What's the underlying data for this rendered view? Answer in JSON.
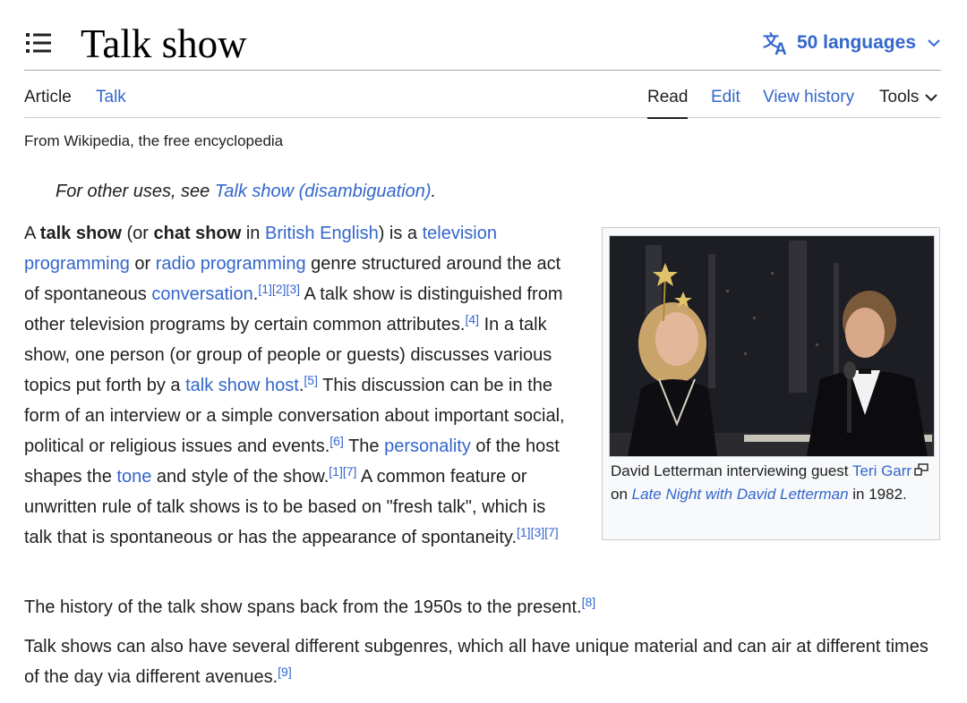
{
  "page": {
    "title": "Talk show",
    "languages_label": "50 languages"
  },
  "tabs": {
    "article": "Article",
    "talk": "Talk",
    "read": "Read",
    "edit": "Edit",
    "view_history": "View history",
    "tools": "Tools"
  },
  "tagline": "From Wikipedia, the free encyclopedia",
  "hatnote": {
    "prefix": "For other uses, see ",
    "link": "Talk show (disambiguation)",
    "suffix": "."
  },
  "lead": {
    "s1": "A ",
    "b1": "talk show",
    "s2": " (or ",
    "b2": "chat show",
    "s3": " in ",
    "l_british": "British English",
    "s4": ") is a ",
    "l_tv": "television programming",
    "s5": " or ",
    "l_radio": "radio programming",
    "s6": " genre structured around the act of spontaneous ",
    "l_conv": "conversation",
    "s7": ".",
    "r1": "[1][2][3]",
    "s8": " A talk show is distinguished from other television programs by certain common attributes.",
    "r2": "[4]",
    "s9": " In a talk show, one person (or group of people or guests) discusses various topics put forth by a ",
    "l_host": "talk show host",
    "s10": ".",
    "r3": "[5]",
    "s11": " This discussion can be in the form of an interview or a simple conversation about important social, political or religious issues and events.",
    "r4": "[6]",
    "s12": " The ",
    "l_personality": "personality",
    "s13": " of the host shapes the ",
    "l_tone": "tone",
    "s14": " and style of the show.",
    "r5": "[1][7]",
    "s15": " A common feature or unwritten rule of talk shows is to be based on \"fresh talk\", which is talk that is spontaneous or has the appearance of spontaneity.",
    "r6": "[1][3][7]"
  },
  "figure": {
    "c1": "David Letterman interviewing guest ",
    "l_teri": "Teri Garr",
    "c2": " on ",
    "l_late": "Late Night with David Letterman",
    "c3": " in 1982."
  },
  "p2": {
    "text": "The history of the talk show spans back from the 1950s to the present.",
    "ref": "[8]"
  },
  "p3": {
    "text": "Talk shows can also have several different subgenres, which all have unique material and can air at different times of the day via different avenues.",
    "ref": "[9]"
  },
  "colors": {
    "link": "#3366cc",
    "text": "#202122",
    "border": "#a2a9b1"
  }
}
